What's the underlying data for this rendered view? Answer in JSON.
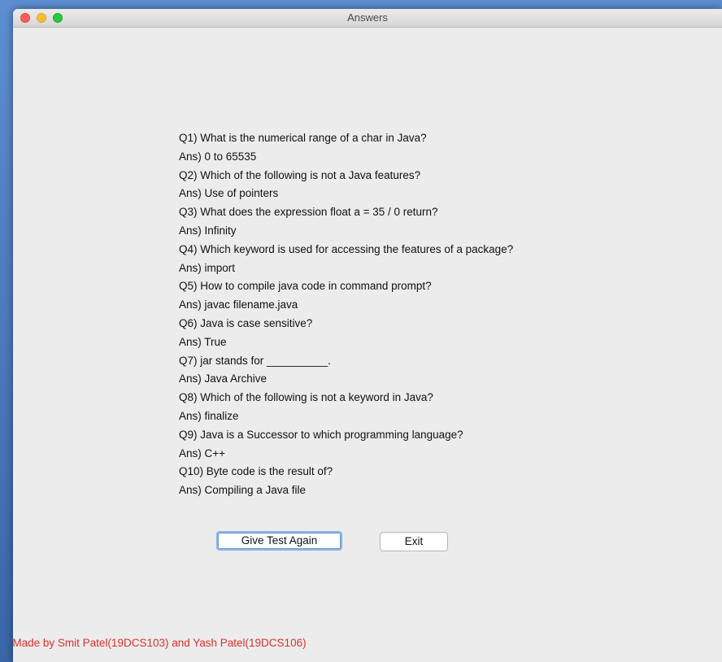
{
  "window": {
    "title": "Answers"
  },
  "answers": [
    "Q1) What is the numerical range of a char in Java?",
    "Ans) 0 to 65535",
    "Q2) Which of the following is not a Java features?",
    "Ans) Use of pointers",
    "Q3) What does the expression float a = 35 / 0 return?",
    "Ans) Infinity",
    "Q4) Which keyword is used for accessing the features of a package?",
    "Ans) import",
    "Q5) How to compile java code in command prompt?",
    "Ans) javac filename.java",
    "Q6) Java is case sensitive?",
    "Ans) True",
    "Q7) jar stands for __________.",
    "Ans) Java Archive",
    "Q8) Which of the following is not a keyword in Java?",
    "Ans) finalize",
    "Q9) Java is a Successor to which programming language?",
    "Ans) C++",
    "Q10) Byte code is the result of?",
    "Ans) Compiling a Java file"
  ],
  "buttons": {
    "give_test_again": "Give Test Again",
    "exit": "Exit"
  },
  "footer": {
    "credit": "Made by Smit Patel(19DCS103) and Yash Patel(19DCS106)"
  },
  "colors": {
    "footer_text": "#d9302e",
    "window_bg": "#ececec"
  }
}
